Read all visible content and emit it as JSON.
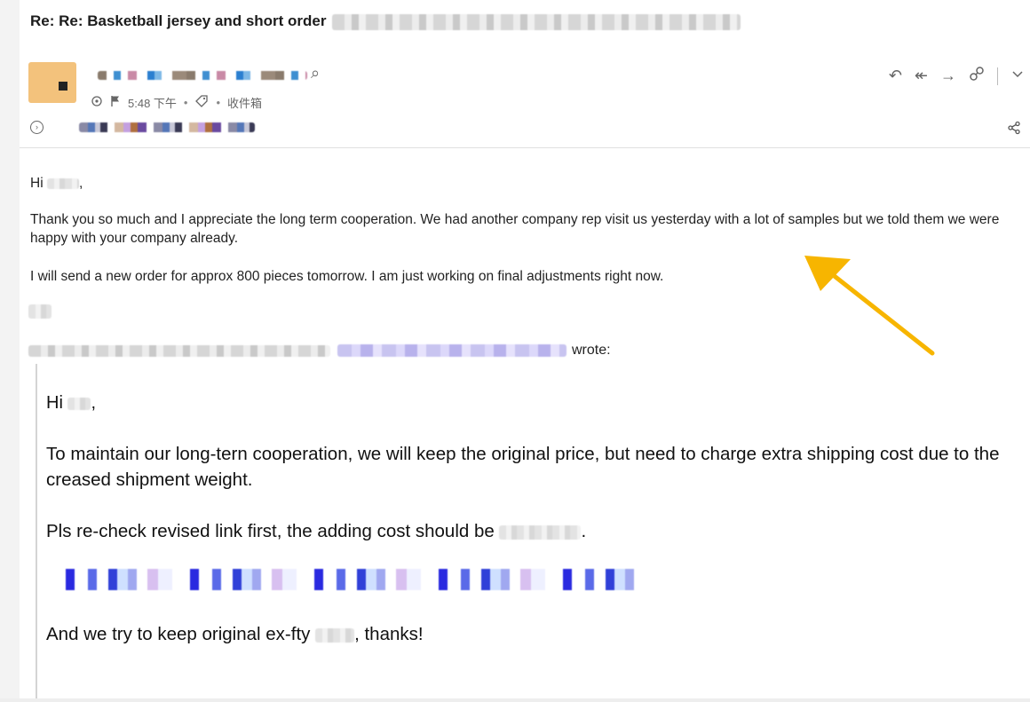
{
  "email": {
    "subject": "Re: Re: Basketball jersey and short order",
    "time": "5:48 下午",
    "folder": "收件箱",
    "meta_separator": "•"
  },
  "toolbar": {
    "actions": [
      "reply-icon",
      "reply-all-icon",
      "forward-icon",
      "link-icon",
      "chevron-down-icon"
    ],
    "reply_glyph": "↶",
    "reply_all_glyph": "↞",
    "forward_glyph": "→",
    "link_glyph": "🔗",
    "more_glyph": "⌄",
    "share_glyph": "⋖",
    "search_glyph": "⌕"
  },
  "message": {
    "greeting": "Hi",
    "greeting_suffix": ",",
    "paragraph1": "Thank you so much and I appreciate the long term cooperation.  We had another company rep visit us yesterday with a lot of samples but we told them we were happy with your company already.",
    "paragraph2": "I will send a new order for approx 800 pieces tomorrow.  I am just working on final adjustments right now."
  },
  "quoted": {
    "wrote_label": "wrote:",
    "greeting": "Hi",
    "greeting_suffix": ",",
    "paragraph1": "To maintain our long-tern cooperation, we will keep the original price, but need to charge extra shipping cost due to the creased shipment weight.",
    "paragraph2": "Pls re-check revised link first, the adding cost should be",
    "paragraph2_suffix": ".",
    "paragraph3": "And we try to keep original ex-fty",
    "paragraph3_suffix": ", thanks!"
  },
  "colors": {
    "avatar": "#f3c27c",
    "annotation_arrow": "#f7b500"
  }
}
